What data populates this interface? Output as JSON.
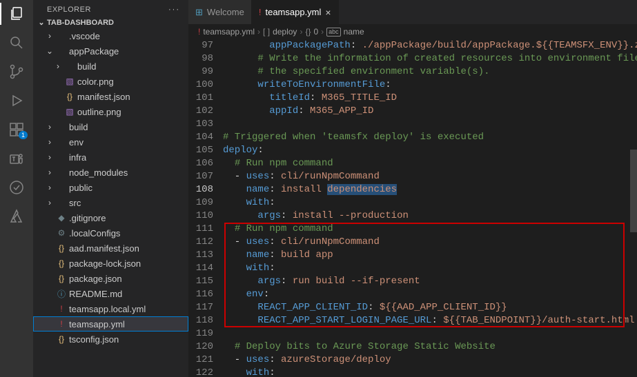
{
  "sidebar": {
    "title": "EXPLORER",
    "section": "TAB-DASHBOARD",
    "items": [
      {
        "label": ".vscode",
        "indent": 1,
        "chev": "›",
        "icon": "",
        "iconClass": ""
      },
      {
        "label": "appPackage",
        "indent": 1,
        "chev": "⌄",
        "icon": "",
        "iconClass": ""
      },
      {
        "label": "build",
        "indent": 2,
        "chev": "›",
        "icon": "",
        "iconClass": ""
      },
      {
        "label": "color.png",
        "indent": 2,
        "chev": "",
        "icon": "▧",
        "iconClass": "ic-purple"
      },
      {
        "label": "manifest.json",
        "indent": 2,
        "chev": "",
        "icon": "{}",
        "iconClass": "ic-yellow"
      },
      {
        "label": "outline.png",
        "indent": 2,
        "chev": "",
        "icon": "▧",
        "iconClass": "ic-purple"
      },
      {
        "label": "build",
        "indent": 1,
        "chev": "›",
        "icon": "",
        "iconClass": ""
      },
      {
        "label": "env",
        "indent": 1,
        "chev": "›",
        "icon": "",
        "iconClass": ""
      },
      {
        "label": "infra",
        "indent": 1,
        "chev": "›",
        "icon": "",
        "iconClass": ""
      },
      {
        "label": "node_modules",
        "indent": 1,
        "chev": "›",
        "icon": "",
        "iconClass": ""
      },
      {
        "label": "public",
        "indent": 1,
        "chev": "›",
        "icon": "",
        "iconClass": ""
      },
      {
        "label": "src",
        "indent": 1,
        "chev": "›",
        "icon": "",
        "iconClass": ""
      },
      {
        "label": ".gitignore",
        "indent": 1,
        "chev": "",
        "icon": "◆",
        "iconClass": "ic-gray"
      },
      {
        "label": ".localConfigs",
        "indent": 1,
        "chev": "",
        "icon": "⚙",
        "iconClass": "ic-gray"
      },
      {
        "label": "aad.manifest.json",
        "indent": 1,
        "chev": "",
        "icon": "{}",
        "iconClass": "ic-yellow"
      },
      {
        "label": "package-lock.json",
        "indent": 1,
        "chev": "",
        "icon": "{}",
        "iconClass": "ic-yellow"
      },
      {
        "label": "package.json",
        "indent": 1,
        "chev": "",
        "icon": "{}",
        "iconClass": "ic-yellow"
      },
      {
        "label": "README.md",
        "indent": 1,
        "chev": "",
        "icon": "ⓘ",
        "iconClass": "ic-blue"
      },
      {
        "label": "teamsapp.local.yml",
        "indent": 1,
        "chev": "",
        "icon": "!",
        "iconClass": "ic-red"
      },
      {
        "label": "teamsapp.yml",
        "indent": 1,
        "chev": "",
        "icon": "!",
        "iconClass": "ic-red",
        "selected": true,
        "outlined": true
      },
      {
        "label": "tsconfig.json",
        "indent": 1,
        "chev": "",
        "icon": "{}",
        "iconClass": "ic-yellow"
      }
    ]
  },
  "tabs": [
    {
      "icon": "⊞",
      "iconClass": "ic-blue",
      "label": "Welcome",
      "active": false,
      "close": false
    },
    {
      "icon": "!",
      "iconClass": "ic-red",
      "label": "teamsapp.yml",
      "active": true,
      "close": true
    }
  ],
  "breadcrumbs": {
    "file": "teamsapp.yml",
    "parts": [
      "deploy",
      "0",
      "name"
    ]
  },
  "editor": {
    "currentLine": 108,
    "highlightBox": {
      "startLine": 111,
      "endLine": 118
    },
    "lines": [
      {
        "n": 97,
        "seg": [
          [
            "        ",
            "ind"
          ],
          [
            "appPackagePath",
            "key"
          ],
          [
            ": ",
            "p"
          ],
          [
            "./appPackage/build/appPackage.${{TEAMSFX_ENV}}.zip",
            "str"
          ]
        ]
      },
      {
        "n": 98,
        "seg": [
          [
            "      ",
            "ind"
          ],
          [
            "# Write the information of created resources into environment file for",
            "com"
          ]
        ]
      },
      {
        "n": 99,
        "seg": [
          [
            "      ",
            "ind"
          ],
          [
            "# the specified environment variable(s).",
            "com"
          ]
        ]
      },
      {
        "n": 100,
        "seg": [
          [
            "      ",
            "ind"
          ],
          [
            "writeToEnvironmentFile",
            "key"
          ],
          [
            ":",
            "p"
          ]
        ]
      },
      {
        "n": 101,
        "seg": [
          [
            "        ",
            "ind"
          ],
          [
            "titleId",
            "key"
          ],
          [
            ": ",
            "p"
          ],
          [
            "M365_TITLE_ID",
            "str"
          ]
        ]
      },
      {
        "n": 102,
        "seg": [
          [
            "        ",
            "ind"
          ],
          [
            "appId",
            "key"
          ],
          [
            ": ",
            "p"
          ],
          [
            "M365_APP_ID",
            "str"
          ]
        ]
      },
      {
        "n": 103,
        "seg": []
      },
      {
        "n": 104,
        "seg": [
          [
            "# Triggered when 'teamsfx deploy' is executed",
            "com"
          ]
        ]
      },
      {
        "n": 105,
        "seg": [
          [
            "deploy",
            "key"
          ],
          [
            ":",
            "p"
          ]
        ]
      },
      {
        "n": 106,
        "seg": [
          [
            "  ",
            "ind"
          ],
          [
            "# Run npm command",
            "com"
          ]
        ]
      },
      {
        "n": 107,
        "seg": [
          [
            "  - ",
            "p"
          ],
          [
            "uses",
            "key"
          ],
          [
            ": ",
            "p"
          ],
          [
            "cli/runNpmCommand",
            "str"
          ]
        ]
      },
      {
        "n": 108,
        "seg": [
          [
            "    ",
            "ind"
          ],
          [
            "name",
            "key"
          ],
          [
            ": ",
            "p"
          ],
          [
            "install ",
            "str"
          ],
          [
            "dependencies",
            "sel"
          ]
        ]
      },
      {
        "n": 109,
        "seg": [
          [
            "    ",
            "ind"
          ],
          [
            "with",
            "key"
          ],
          [
            ":",
            "p"
          ]
        ]
      },
      {
        "n": 110,
        "seg": [
          [
            "      ",
            "ind"
          ],
          [
            "args",
            "key"
          ],
          [
            ": ",
            "p"
          ],
          [
            "install --production",
            "str"
          ]
        ]
      },
      {
        "n": 111,
        "seg": [
          [
            "  ",
            "ind"
          ],
          [
            "# Run npm command",
            "com"
          ]
        ]
      },
      {
        "n": 112,
        "seg": [
          [
            "  - ",
            "p"
          ],
          [
            "uses",
            "key"
          ],
          [
            ": ",
            "p"
          ],
          [
            "cli/runNpmCommand",
            "str"
          ]
        ]
      },
      {
        "n": 113,
        "seg": [
          [
            "    ",
            "ind"
          ],
          [
            "name",
            "key"
          ],
          [
            ": ",
            "p"
          ],
          [
            "build app",
            "str"
          ]
        ]
      },
      {
        "n": 114,
        "seg": [
          [
            "    ",
            "ind"
          ],
          [
            "with",
            "key"
          ],
          [
            ":",
            "p"
          ]
        ]
      },
      {
        "n": 115,
        "seg": [
          [
            "      ",
            "ind"
          ],
          [
            "args",
            "key"
          ],
          [
            ": ",
            "p"
          ],
          [
            "run build --if-present",
            "str"
          ]
        ]
      },
      {
        "n": 116,
        "seg": [
          [
            "    ",
            "ind"
          ],
          [
            "env",
            "key"
          ],
          [
            ":",
            "p"
          ]
        ]
      },
      {
        "n": 117,
        "seg": [
          [
            "      ",
            "ind"
          ],
          [
            "REACT_APP_CLIENT_ID",
            "key"
          ],
          [
            ": ",
            "p"
          ],
          [
            "${{AAD_APP_CLIENT_ID}}",
            "str"
          ]
        ]
      },
      {
        "n": 118,
        "seg": [
          [
            "      ",
            "ind"
          ],
          [
            "REACT_APP_START_LOGIN_PAGE_URL",
            "key"
          ],
          [
            ": ",
            "p"
          ],
          [
            "${{TAB_ENDPOINT}}/auth-start.html",
            "str"
          ]
        ]
      },
      {
        "n": 119,
        "seg": []
      },
      {
        "n": 120,
        "seg": [
          [
            "  ",
            "ind"
          ],
          [
            "# Deploy bits to Azure Storage Static Website",
            "com"
          ]
        ]
      },
      {
        "n": 121,
        "seg": [
          [
            "  - ",
            "p"
          ],
          [
            "uses",
            "key"
          ],
          [
            ": ",
            "p"
          ],
          [
            "azureStorage/deploy",
            "str"
          ]
        ]
      },
      {
        "n": 122,
        "seg": [
          [
            "    ",
            "ind"
          ],
          [
            "with",
            "key"
          ],
          [
            ":",
            "p"
          ]
        ]
      }
    ]
  },
  "activityBadge": "1"
}
